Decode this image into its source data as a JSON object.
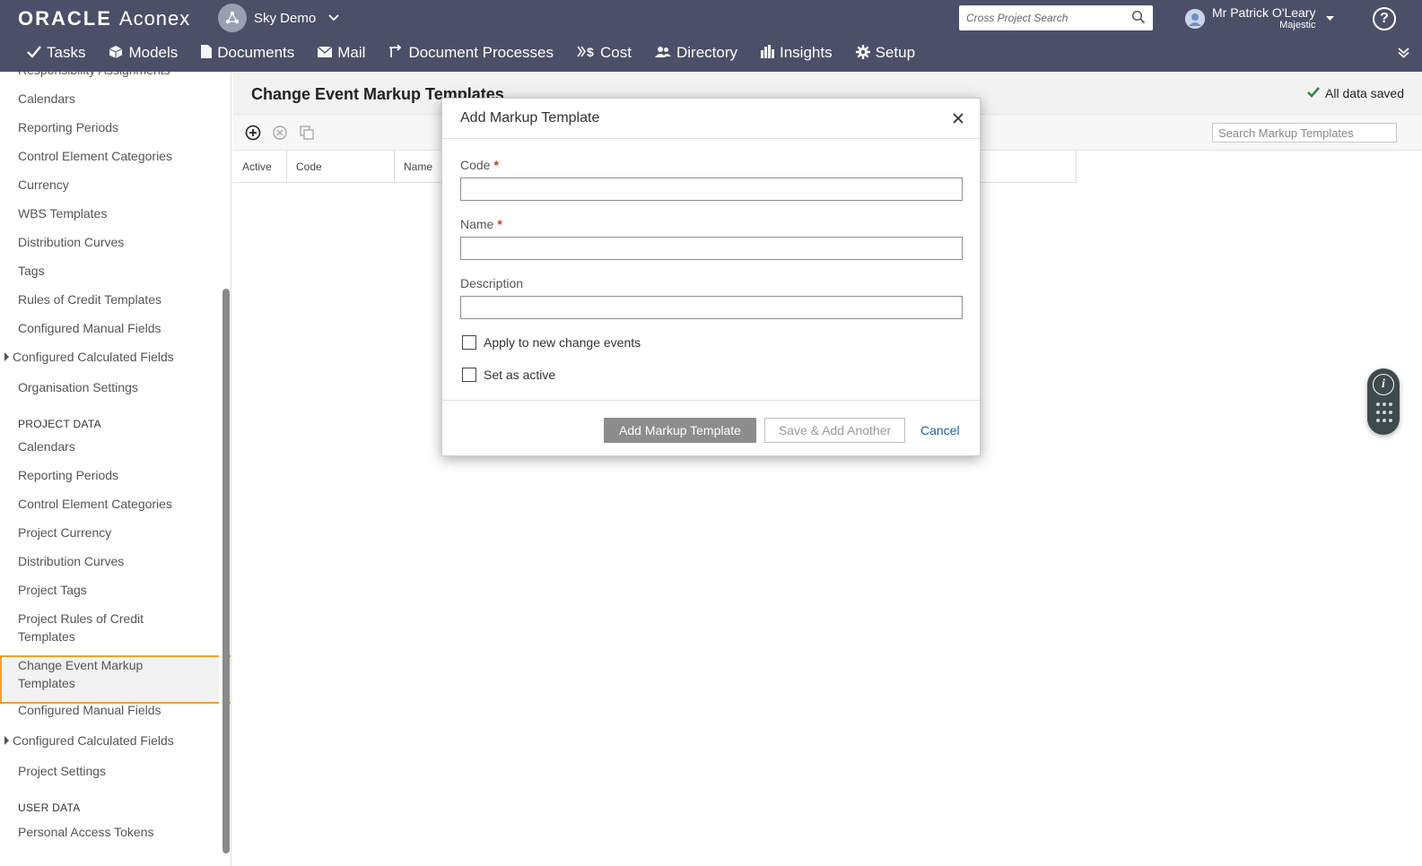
{
  "brand": {
    "oracle": "ORACLE",
    "product": "Aconex"
  },
  "project": {
    "name": "Sky Demo"
  },
  "search": {
    "placeholder": "Cross Project Search"
  },
  "user": {
    "name": "Mr Patrick O'Leary",
    "org": "Majestic"
  },
  "help": {
    "label": "?"
  },
  "nav": [
    {
      "label": "Tasks",
      "icon": "check-icon"
    },
    {
      "label": "Models",
      "icon": "cube-icon"
    },
    {
      "label": "Documents",
      "icon": "document-icon"
    },
    {
      "label": "Mail",
      "icon": "envelope-icon"
    },
    {
      "label": "Document Processes",
      "icon": "workflow-icon"
    },
    {
      "label": "Cost",
      "icon": "cost-icon"
    },
    {
      "label": "Directory",
      "icon": "people-icon"
    },
    {
      "label": "Insights",
      "icon": "bar-chart-icon"
    },
    {
      "label": "Setup",
      "icon": "gear-icon"
    }
  ],
  "sidebar": {
    "org_items": [
      "Responsibility Assignments",
      "Calendars",
      "Reporting Periods",
      "Control Element Categories",
      "Currency",
      "WBS Templates",
      "Distribution Curves",
      "Tags",
      "Rules of Credit Templates",
      "Configured Manual Fields",
      "Configured Calculated Fields",
      "Organisation Settings"
    ],
    "project_heading": "PROJECT DATA",
    "project_items": [
      "Calendars",
      "Reporting Periods",
      "Control Element Categories",
      "Project Currency",
      "Distribution Curves",
      "Project Tags",
      "Project Rules of Credit Templates",
      "Change Event Markup Templates",
      "Configured Manual Fields",
      "Configured Calculated Fields",
      "Project Settings"
    ],
    "user_heading": "USER DATA",
    "user_items": [
      "Personal Access Tokens"
    ]
  },
  "main": {
    "title": "Change Event Markup Templates",
    "saved_status": "All data saved",
    "search_placeholder": "Search Markup Templates",
    "columns": [
      "Active",
      "Code",
      "Name"
    ]
  },
  "modal": {
    "title": "Add Markup Template",
    "code_label": "Code",
    "name_label": "Name",
    "description_label": "Description",
    "required_mark": "*",
    "apply_label": "Apply to new change events",
    "active_label": "Set as active",
    "primary_button": "Add Markup Template",
    "secondary_button": "Save & Add Another",
    "cancel_button": "Cancel"
  },
  "colors": {
    "topbar": "#4b5068",
    "selection_border": "#f0a030",
    "link": "#1d5fa5",
    "required": "#c0392b"
  }
}
